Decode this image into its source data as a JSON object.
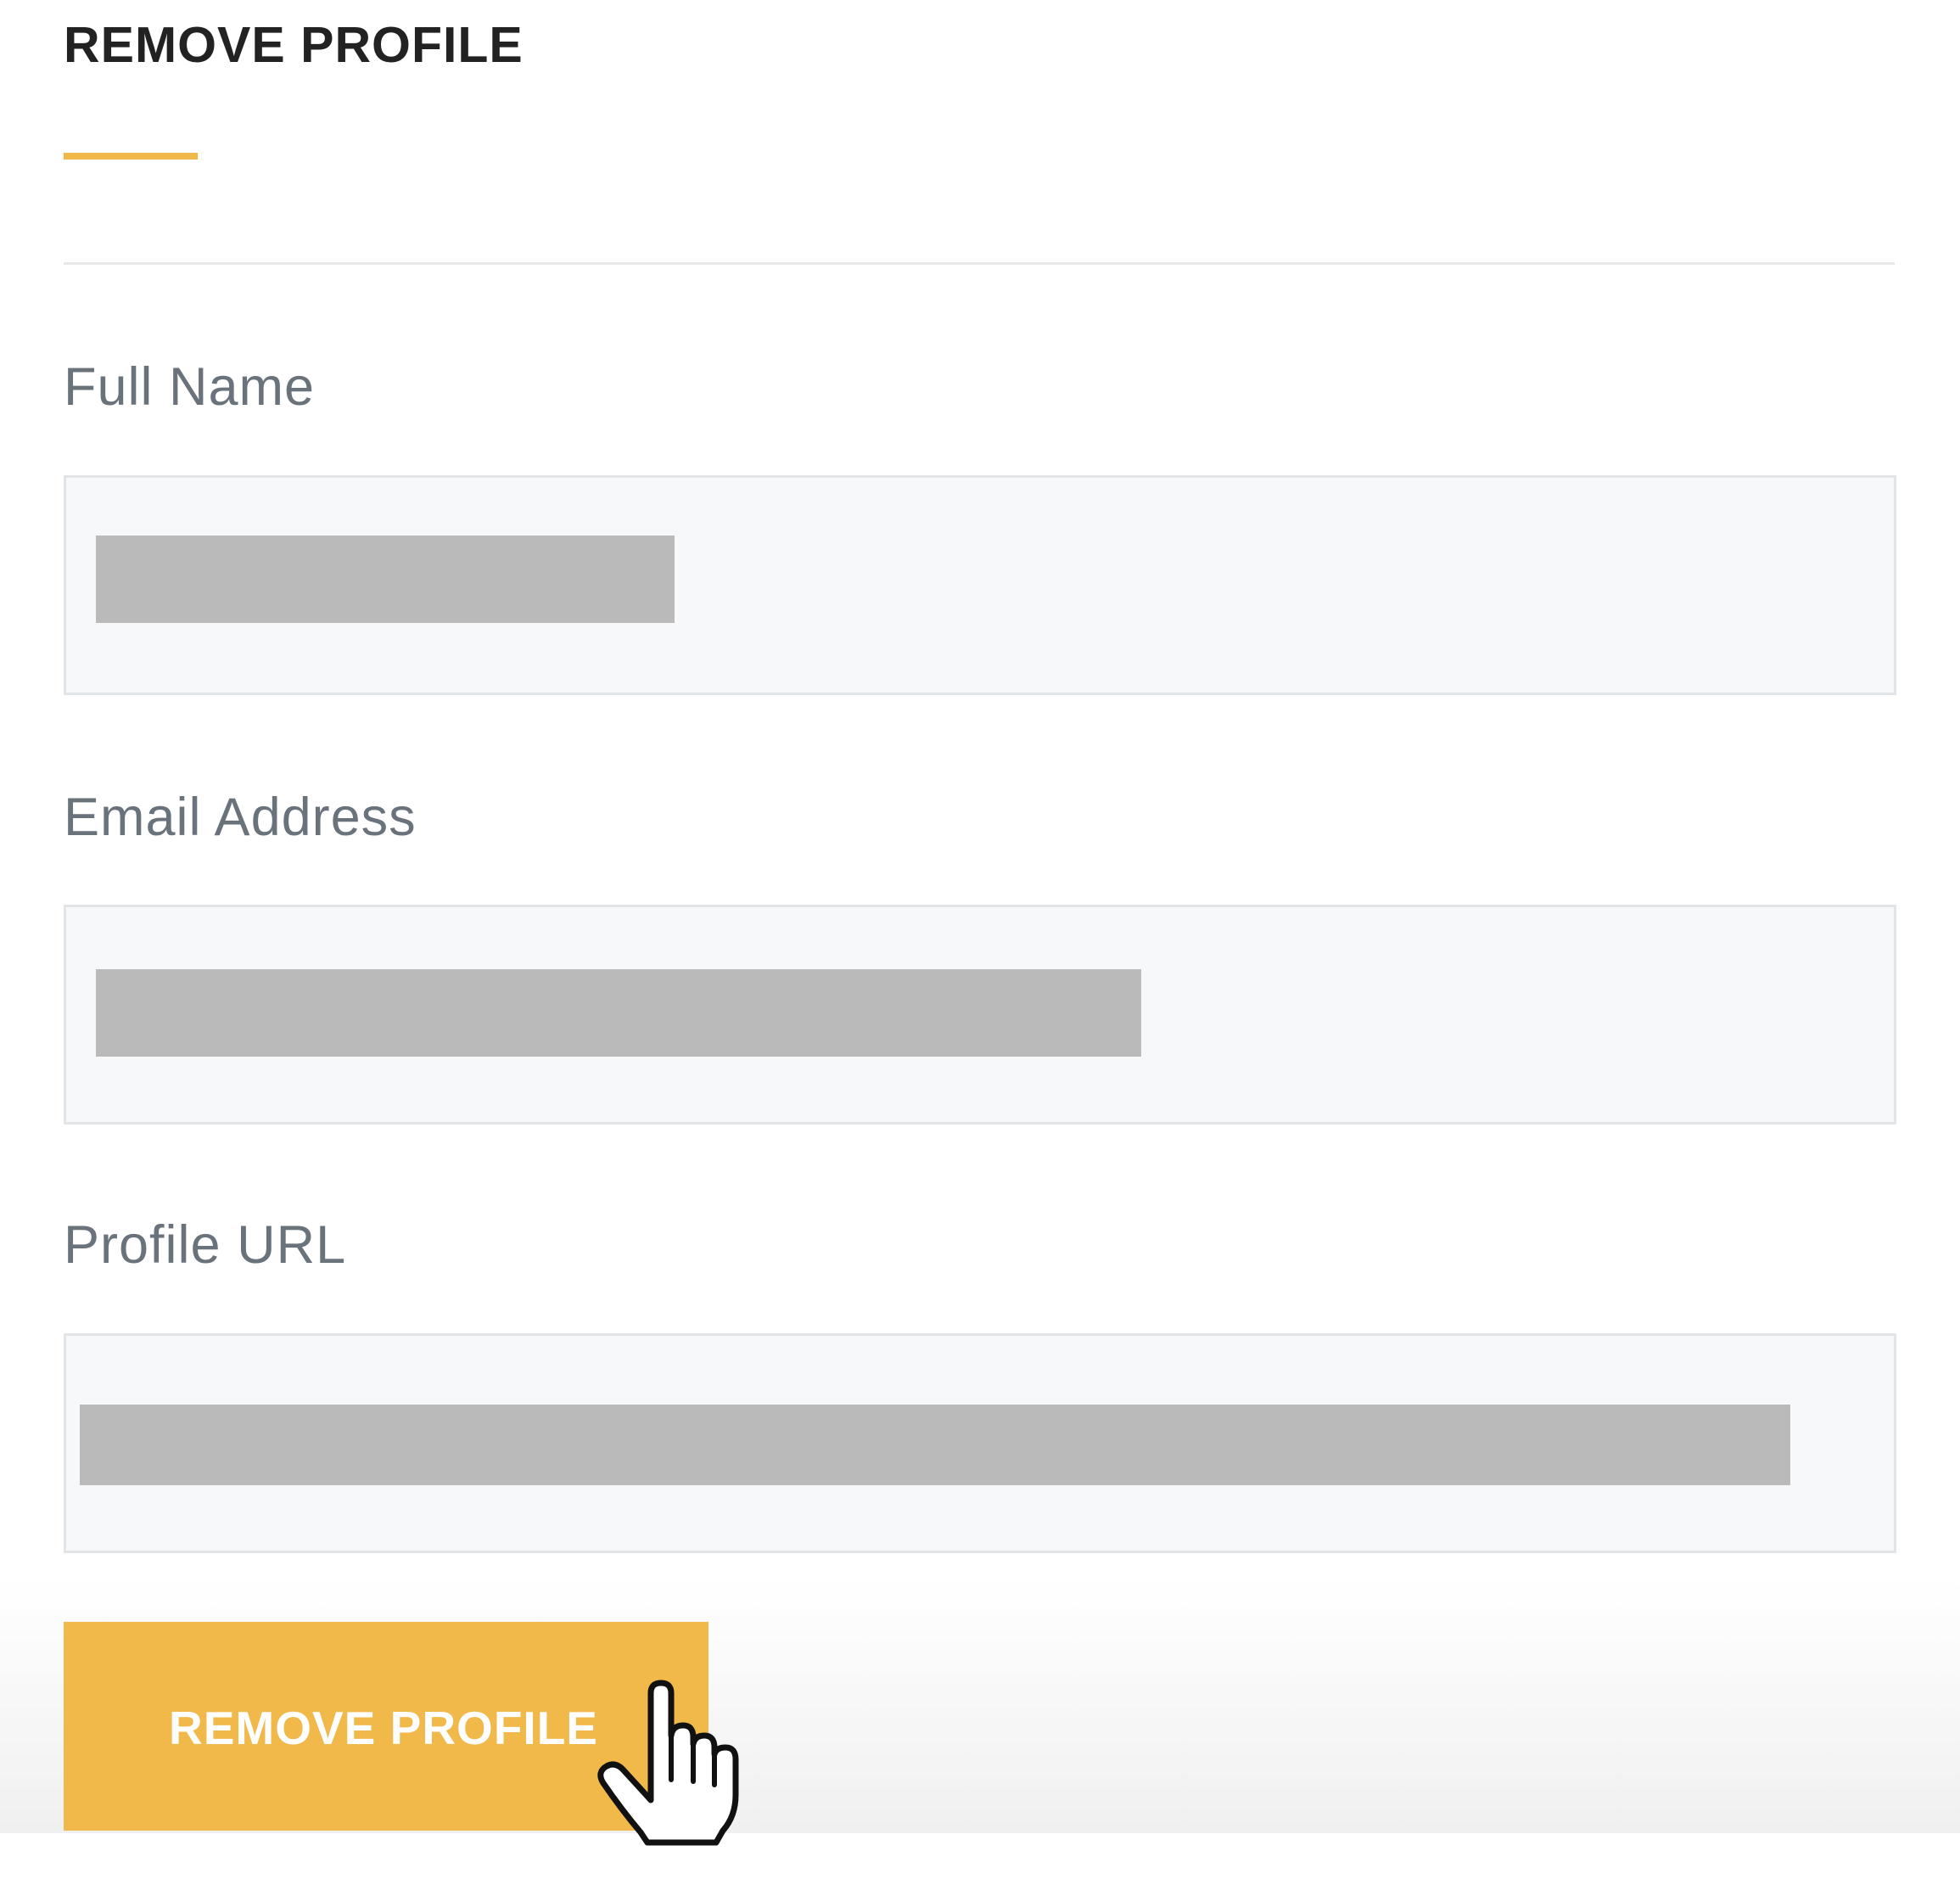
{
  "title": "REMOVE PROFILE",
  "accent_color": "#f0b849",
  "fields": [
    {
      "label": "Full Name",
      "value": ""
    },
    {
      "label": "Email Address",
      "value": ""
    },
    {
      "label": "Profile URL",
      "value": ""
    }
  ],
  "button": {
    "label": "REMOVE PROFILE",
    "color": "#f1b84a"
  },
  "cursor": "hand-pointer-icon"
}
